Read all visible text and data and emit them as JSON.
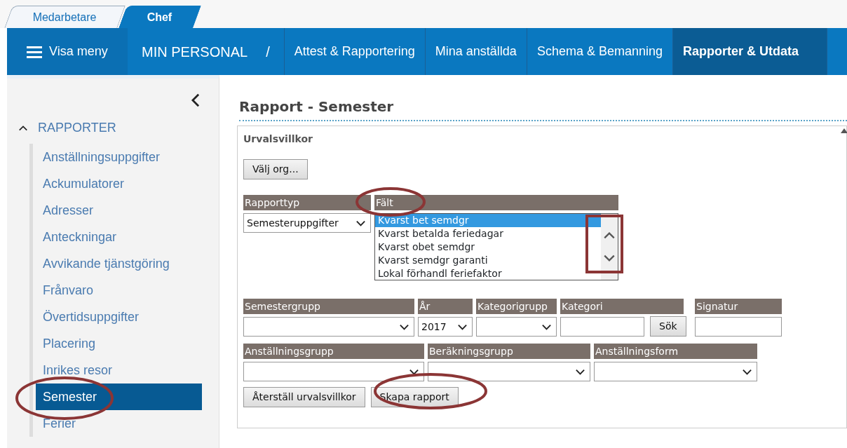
{
  "top_tabs": [
    {
      "label": "Medarbetare",
      "selected": false
    },
    {
      "label": "Chef",
      "selected": true
    }
  ],
  "navbar": {
    "menu_button": "Visa meny",
    "section": "MIN PERSONAL",
    "separator": "/",
    "links": [
      {
        "label": "Attest & Rapportering",
        "selected": false
      },
      {
        "label": "Mina anställda",
        "selected": false
      },
      {
        "label": "Schema & Bemanning",
        "selected": false
      },
      {
        "label": "Rapporter & Utdata",
        "selected": true
      }
    ]
  },
  "sidebar": {
    "group": {
      "label": "RAPPORTER",
      "expanded": true
    },
    "items": [
      {
        "label": "Anställningsuppgifter",
        "selected": false
      },
      {
        "label": "Ackumulatorer",
        "selected": false
      },
      {
        "label": "Adresser",
        "selected": false
      },
      {
        "label": "Anteckningar",
        "selected": false
      },
      {
        "label": "Avvikande tjänstgöring",
        "selected": false
      },
      {
        "label": "Frånvaro",
        "selected": false
      },
      {
        "label": "Övertidsuppgifter",
        "selected": false
      },
      {
        "label": "Placering",
        "selected": false
      },
      {
        "label": "Inrikes resor",
        "selected": false
      },
      {
        "label": "Semester",
        "selected": true
      },
      {
        "label": "Ferier",
        "selected": false
      }
    ]
  },
  "main": {
    "title": "Rapport - Semester",
    "panel_title": "Urvalsvillkor",
    "org_button": "Välj org...",
    "filter_lines": [
      {
        "fields": [
          {
            "kind": "select",
            "label": "Rapporttyp",
            "value": "Semesteruppgifter"
          },
          {
            "kind": "listbox",
            "label": "Fält",
            "options": [
              {
                "label": "Kvarst bet semdgr",
                "selected": true
              },
              {
                "label": "Kvarst betalda feriedagar",
                "selected": false
              },
              {
                "label": "Kvarst obet semdgr",
                "selected": false
              },
              {
                "label": "Kvarst semdgr garanti",
                "selected": false
              },
              {
                "label": "Lokal förhandl feriefaktor",
                "selected": false
              }
            ]
          }
        ]
      },
      {
        "fields": [
          {
            "kind": "select",
            "label": "Semestergrupp"
          },
          {
            "kind": "select",
            "label": "År",
            "value": "2017"
          },
          {
            "kind": "select",
            "label": "Kategorigrupp"
          },
          {
            "kind": "search",
            "label": "Kategori",
            "button": "Sök"
          },
          {
            "kind": "input",
            "label": "Signatur"
          }
        ]
      },
      {
        "fields": [
          {
            "kind": "select",
            "label": "Anställningsgrupp"
          },
          {
            "kind": "select",
            "label": "Beräkningsgrupp"
          },
          {
            "kind": "select",
            "label": "Anställningsform"
          }
        ]
      }
    ],
    "buttons": [
      "Återställ urvalsvillkor",
      "Skapa rapport"
    ]
  }
}
